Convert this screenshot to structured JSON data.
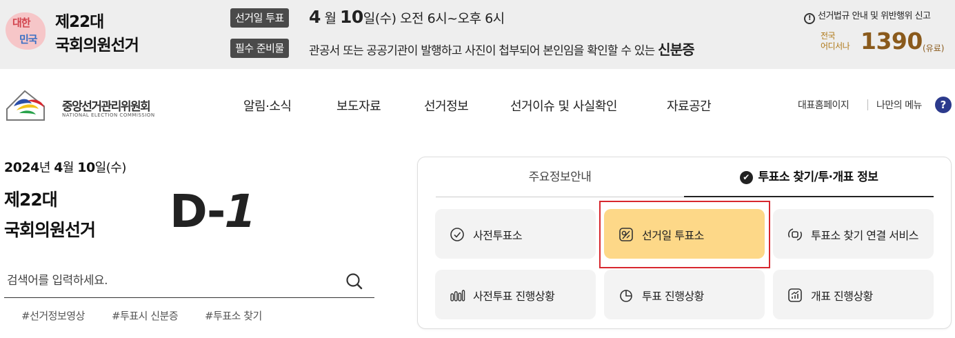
{
  "banner": {
    "emblem_text_top": "대한",
    "emblem_text_bottom": "민국",
    "title_line1": "제22대",
    "title_line2": "국회의원선거",
    "vote_day_chip": "선거일 투표",
    "vote_month_num": "4",
    "vote_month_unit": "월",
    "vote_day_num": "10",
    "vote_day_rest": "일(수) 오전 6시~오후 6시",
    "required_chip": "필수 준비물",
    "required_text": "관공서 또는 공공기관이 발행하고 사진이 첩부되어 본인임을 확인할 수 있는",
    "required_item": "신분증",
    "report_link": "선거법규 안내 및 위반행위 신고",
    "hotline_label_1": "전국",
    "hotline_label_2": "어디서나",
    "hotline_number": "1390",
    "hotline_paid": "(유료)"
  },
  "nav": {
    "logo_text": "중앙선거관리위원회",
    "logo_subtext": "NATIONAL ELECTION COMMISSION",
    "menu": [
      "알림·소식",
      "보도자료",
      "선거정보",
      "선거이슈 및 사실확인",
      "자료공간"
    ],
    "util_home": "대표홈페이지",
    "util_my_menu": "나만의 메뉴",
    "help_glyph": "?"
  },
  "dday": {
    "year": "2024",
    "year_unit": "년",
    "month": "4",
    "month_unit": "월",
    "day": "10",
    "day_rest": "일(수)",
    "title_line1": "제22대",
    "title_line2": "국회의원선거",
    "prefix": "D-",
    "count": "1"
  },
  "search": {
    "placeholder": "검색어를 입력하세요.",
    "tags": [
      "#선거정보영상",
      "#투표시 신분증",
      "#투표소 찾기"
    ]
  },
  "panel": {
    "tabs": [
      {
        "label": "주요정보안내",
        "active": false
      },
      {
        "label": "투표소 찾기/투·개표 정보",
        "active": true
      }
    ],
    "check_glyph": "✔",
    "cards": [
      {
        "label": "사전투표소",
        "icon": "check-circle-icon"
      },
      {
        "label": "선거일 투표소",
        "icon": "ballot-icon",
        "active": true
      },
      {
        "label": "투표소 찾기 연결 서비스",
        "icon": "link-service-icon"
      },
      {
        "label": "사전투표 진행상황",
        "icon": "bar-chart-icon"
      },
      {
        "label": "투표 진행상황",
        "icon": "pie-chart-icon"
      },
      {
        "label": "개표 진행상황",
        "icon": "trend-chart-icon"
      }
    ]
  },
  "colors": {
    "banner_bg": "#eeeeee",
    "chip_bg": "#4a4a4a",
    "hotline": "#8a5a1c",
    "active_card": "#fdd888",
    "highlight_border": "#d7272e",
    "help_icon": "#2c3a8c"
  }
}
